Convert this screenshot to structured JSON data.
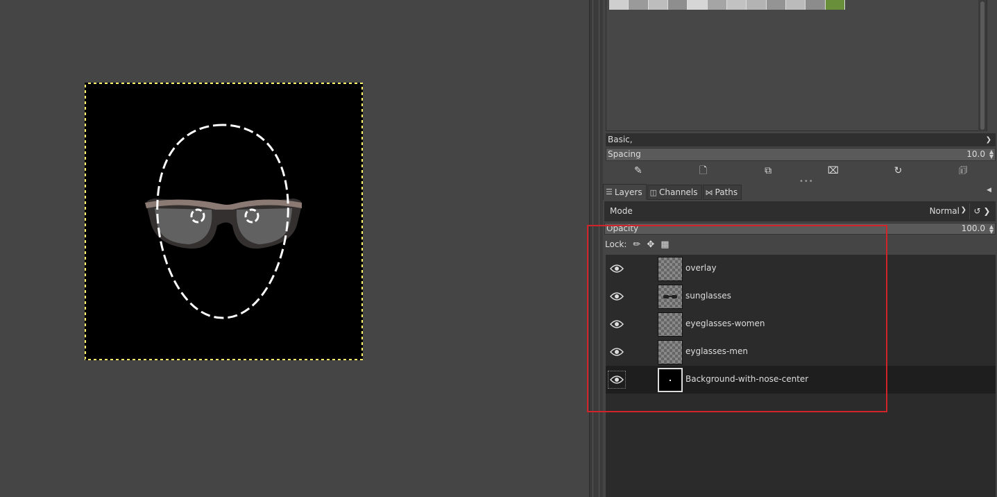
{
  "brushes": {
    "preset": "Basic,",
    "spacing_label": "Spacing",
    "spacing_value": "10.0"
  },
  "tabs": [
    {
      "label": "Layers",
      "icon": "layers-icon"
    },
    {
      "label": "Channels",
      "icon": "channels-icon"
    },
    {
      "label": "Paths",
      "icon": "paths-icon"
    }
  ],
  "layers_panel": {
    "mode_label": "Mode",
    "mode_value": "Normal",
    "opacity_label": "Opacity",
    "opacity_value": "100.0",
    "lock_label": "Lock:",
    "layers": [
      {
        "name": "overlay",
        "visible": true
      },
      {
        "name": "sunglasses",
        "visible": true
      },
      {
        "name": "eyeglasses-women",
        "visible": true
      },
      {
        "name": "eyglasses-men",
        "visible": true
      },
      {
        "name": "Background-with-nose-center",
        "visible": true,
        "selected": true
      }
    ]
  },
  "colors": {
    "highlight": "#d1232a",
    "background": "#454545"
  }
}
